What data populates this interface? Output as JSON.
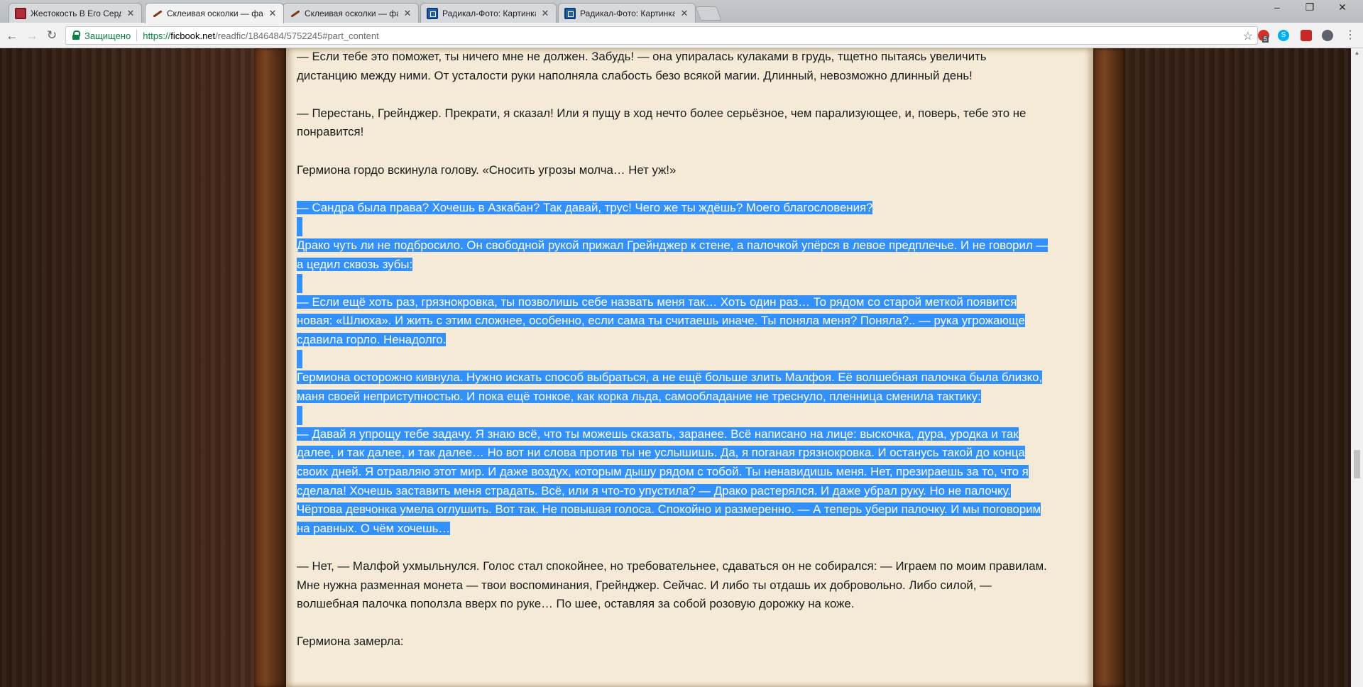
{
  "browser": {
    "tabs": [
      {
        "title": "Жестокость В Его Серд",
        "icon": "book-icon"
      },
      {
        "title": "Склеивая осколки — фа",
        "icon": "quill-icon",
        "active": true
      },
      {
        "title": "Склеивая осколки — фа",
        "icon": "quill-icon"
      },
      {
        "title": "Радикал-Фото: Картинка",
        "icon": "radikal-icon"
      },
      {
        "title": "Радикал-Фото: Картинка",
        "icon": "radikal-icon"
      }
    ],
    "secure_label": "Защищено",
    "url_scheme": "https://",
    "url_host": "ficbook.net",
    "url_path": "/readfic/1846484/5752245#part_content",
    "ext_badge": "5"
  },
  "content": {
    "paragraphs": [
      {
        "text": "— Если тебе это поможет, ты ничего мне не должен. Забудь! — она упиралась кулаками в грудь, тщетно пытаясь увеличить дистанцию между ними. От усталости руки наполняла слабость безо всякой магии. Длинный, невозможно длинный день!"
      },
      {
        "text": "— Перестань, Грейнджер. Прекрати, я сказал! Или я пущу в ход нечто более серьёзное, чем парализующее, и, поверь, тебе это не понравится!"
      },
      {
        "text": "Гермиона гордо вскинула голову. «Сносить угрозы молча… Нет уж!»"
      },
      {
        "text": "— Сандра была права? Хочешь в Азкабан? Так давай, трус! Чего же ты ждёшь? Моего благословения?",
        "selected": true
      },
      {
        "text": "Драко чуть ли не подбросило. Он свободной рукой прижал Грейнджер к стене, а палочкой упёрся в левое предплечье. И не говорил — а цедил сквозь зубы:",
        "selected": true
      },
      {
        "text": "— Если ещё хоть раз, грязнокровка, ты позволишь себе назвать меня так… Хоть один раз… То рядом со старой меткой появится новая: «Шлюха». И жить с этим сложнее, особенно, если сама ты считаешь иначе. Ты поняла меня? Поняла?.. — рука угрожающе сдавила горло. Ненадолго.",
        "selected": true
      },
      {
        "text": "Гермиона осторожно кивнула. Нужно искать способ выбраться, а не ещё больше злить Малфоя. Её волшебная палочка была близко, маня своей неприступностью. И пока ещё тонкое, как корка льда, самообладание не треснуло, пленница сменила тактику:",
        "selected": true
      },
      {
        "text": "— Давай я упрощу тебе задачу. Я знаю всё, что ты можешь сказать, заранее. Всё написано на лице: выскочка, дура, уродка и так далее, и так далее, и так далее… Но вот ни слова против ты не услышишь. Да, я поганая грязнокровка. И останусь такой до конца своих дней. Я отравляю этот мир. И даже воздух, которым дышу рядом с тобой. Ты ненавидишь меня. Нет, презираешь за то, что я сделала! Хочешь заставить меня страдать. Всё, или я что-то упустила? — Драко растерялся. И даже убрал руку. Но не палочку. Чёртова девчонка умела оглушить. Вот так. Не повышая голоса. Спокойно и размеренно. — А теперь убери палочку. И мы поговорим на равных. О чём хочешь…",
        "selected": true
      },
      {
        "text": "— Нет, — Малфой ухмыльнулся. Голос стал спокойнее, но требовательнее, сдаваться он не собирался: — Играем по моим правилам. Мне нужна разменная монета — твои воспоминания, Грейнджер. Сейчас. И либо ты отдашь их добровольно. Либо силой, — волшебная палочка поползла вверх по руке… По шее, оставляя за собой розовую дорожку на коже."
      },
      {
        "text": "Гермиона замерла:"
      }
    ]
  },
  "colors": {
    "selection": "#3390ff",
    "parchment": "#f4ead6",
    "secure_green": "#0b8043"
  }
}
